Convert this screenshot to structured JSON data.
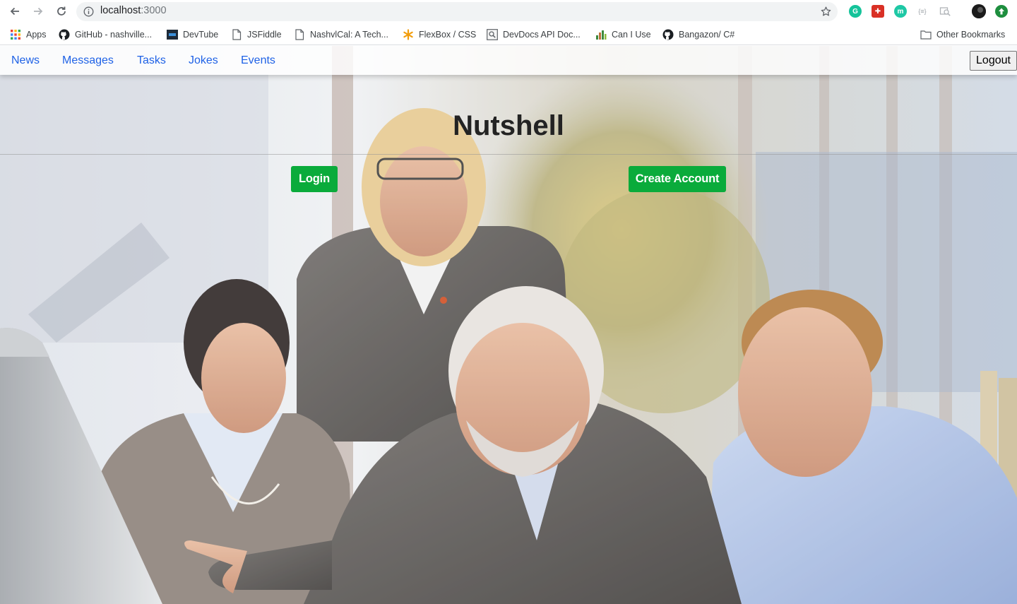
{
  "browser": {
    "url_host": "localhost",
    "url_port": ":3000",
    "nav_icons": [
      "back-arrow-icon",
      "forward-arrow-icon",
      "reload-icon"
    ],
    "extensions": [
      {
        "name": "grammarly-extension-icon",
        "color": "#15c39a",
        "glyph": "G"
      },
      {
        "name": "red-extension-icon",
        "color": "#d93025",
        "glyph": "✚"
      },
      {
        "name": "teal-extension-icon",
        "color": "#1ec8a5",
        "glyph": "m"
      },
      {
        "name": "json-extension-icon",
        "color": "#9aa0a6",
        "glyph": "{≡}"
      },
      {
        "name": "inspect-extension-icon",
        "color": "#9aa0a6",
        "glyph": "🔍"
      },
      {
        "name": "profile-avatar-icon",
        "color": "#202124",
        "glyph": ""
      },
      {
        "name": "update-arrow-icon",
        "color": "#1e8e3e",
        "glyph": "⬆"
      }
    ]
  },
  "bookmarks": {
    "items": [
      {
        "label": "Apps",
        "icon": "apps-grid-icon"
      },
      {
        "label": "GitHub - nashville...",
        "icon": "github-icon"
      },
      {
        "label": "DevTube",
        "icon": "devtube-icon"
      },
      {
        "label": "JSFiddle",
        "icon": "page-icon"
      },
      {
        "label": "NashvlCal: A Tech...",
        "icon": "page-icon"
      },
      {
        "label": "FlexBox / CSS",
        "icon": "asterisk-icon"
      },
      {
        "label": "DevDocs API Doc...",
        "icon": "devdocs-icon"
      },
      {
        "label": "Can I Use",
        "icon": "caniuse-icon"
      },
      {
        "label": "Bangazon/ C#",
        "icon": "github-icon"
      }
    ],
    "other": {
      "label": "Other Bookmarks",
      "icon": "folder-icon"
    }
  },
  "app": {
    "nav": [
      "News",
      "Messages",
      "Tasks",
      "Jokes",
      "Events"
    ],
    "logout": "Logout",
    "title": "Nutshell",
    "login": "Login",
    "create_account": "Create Account"
  },
  "colors": {
    "link": "#1f62e6",
    "button_green": "#0aab3b"
  }
}
